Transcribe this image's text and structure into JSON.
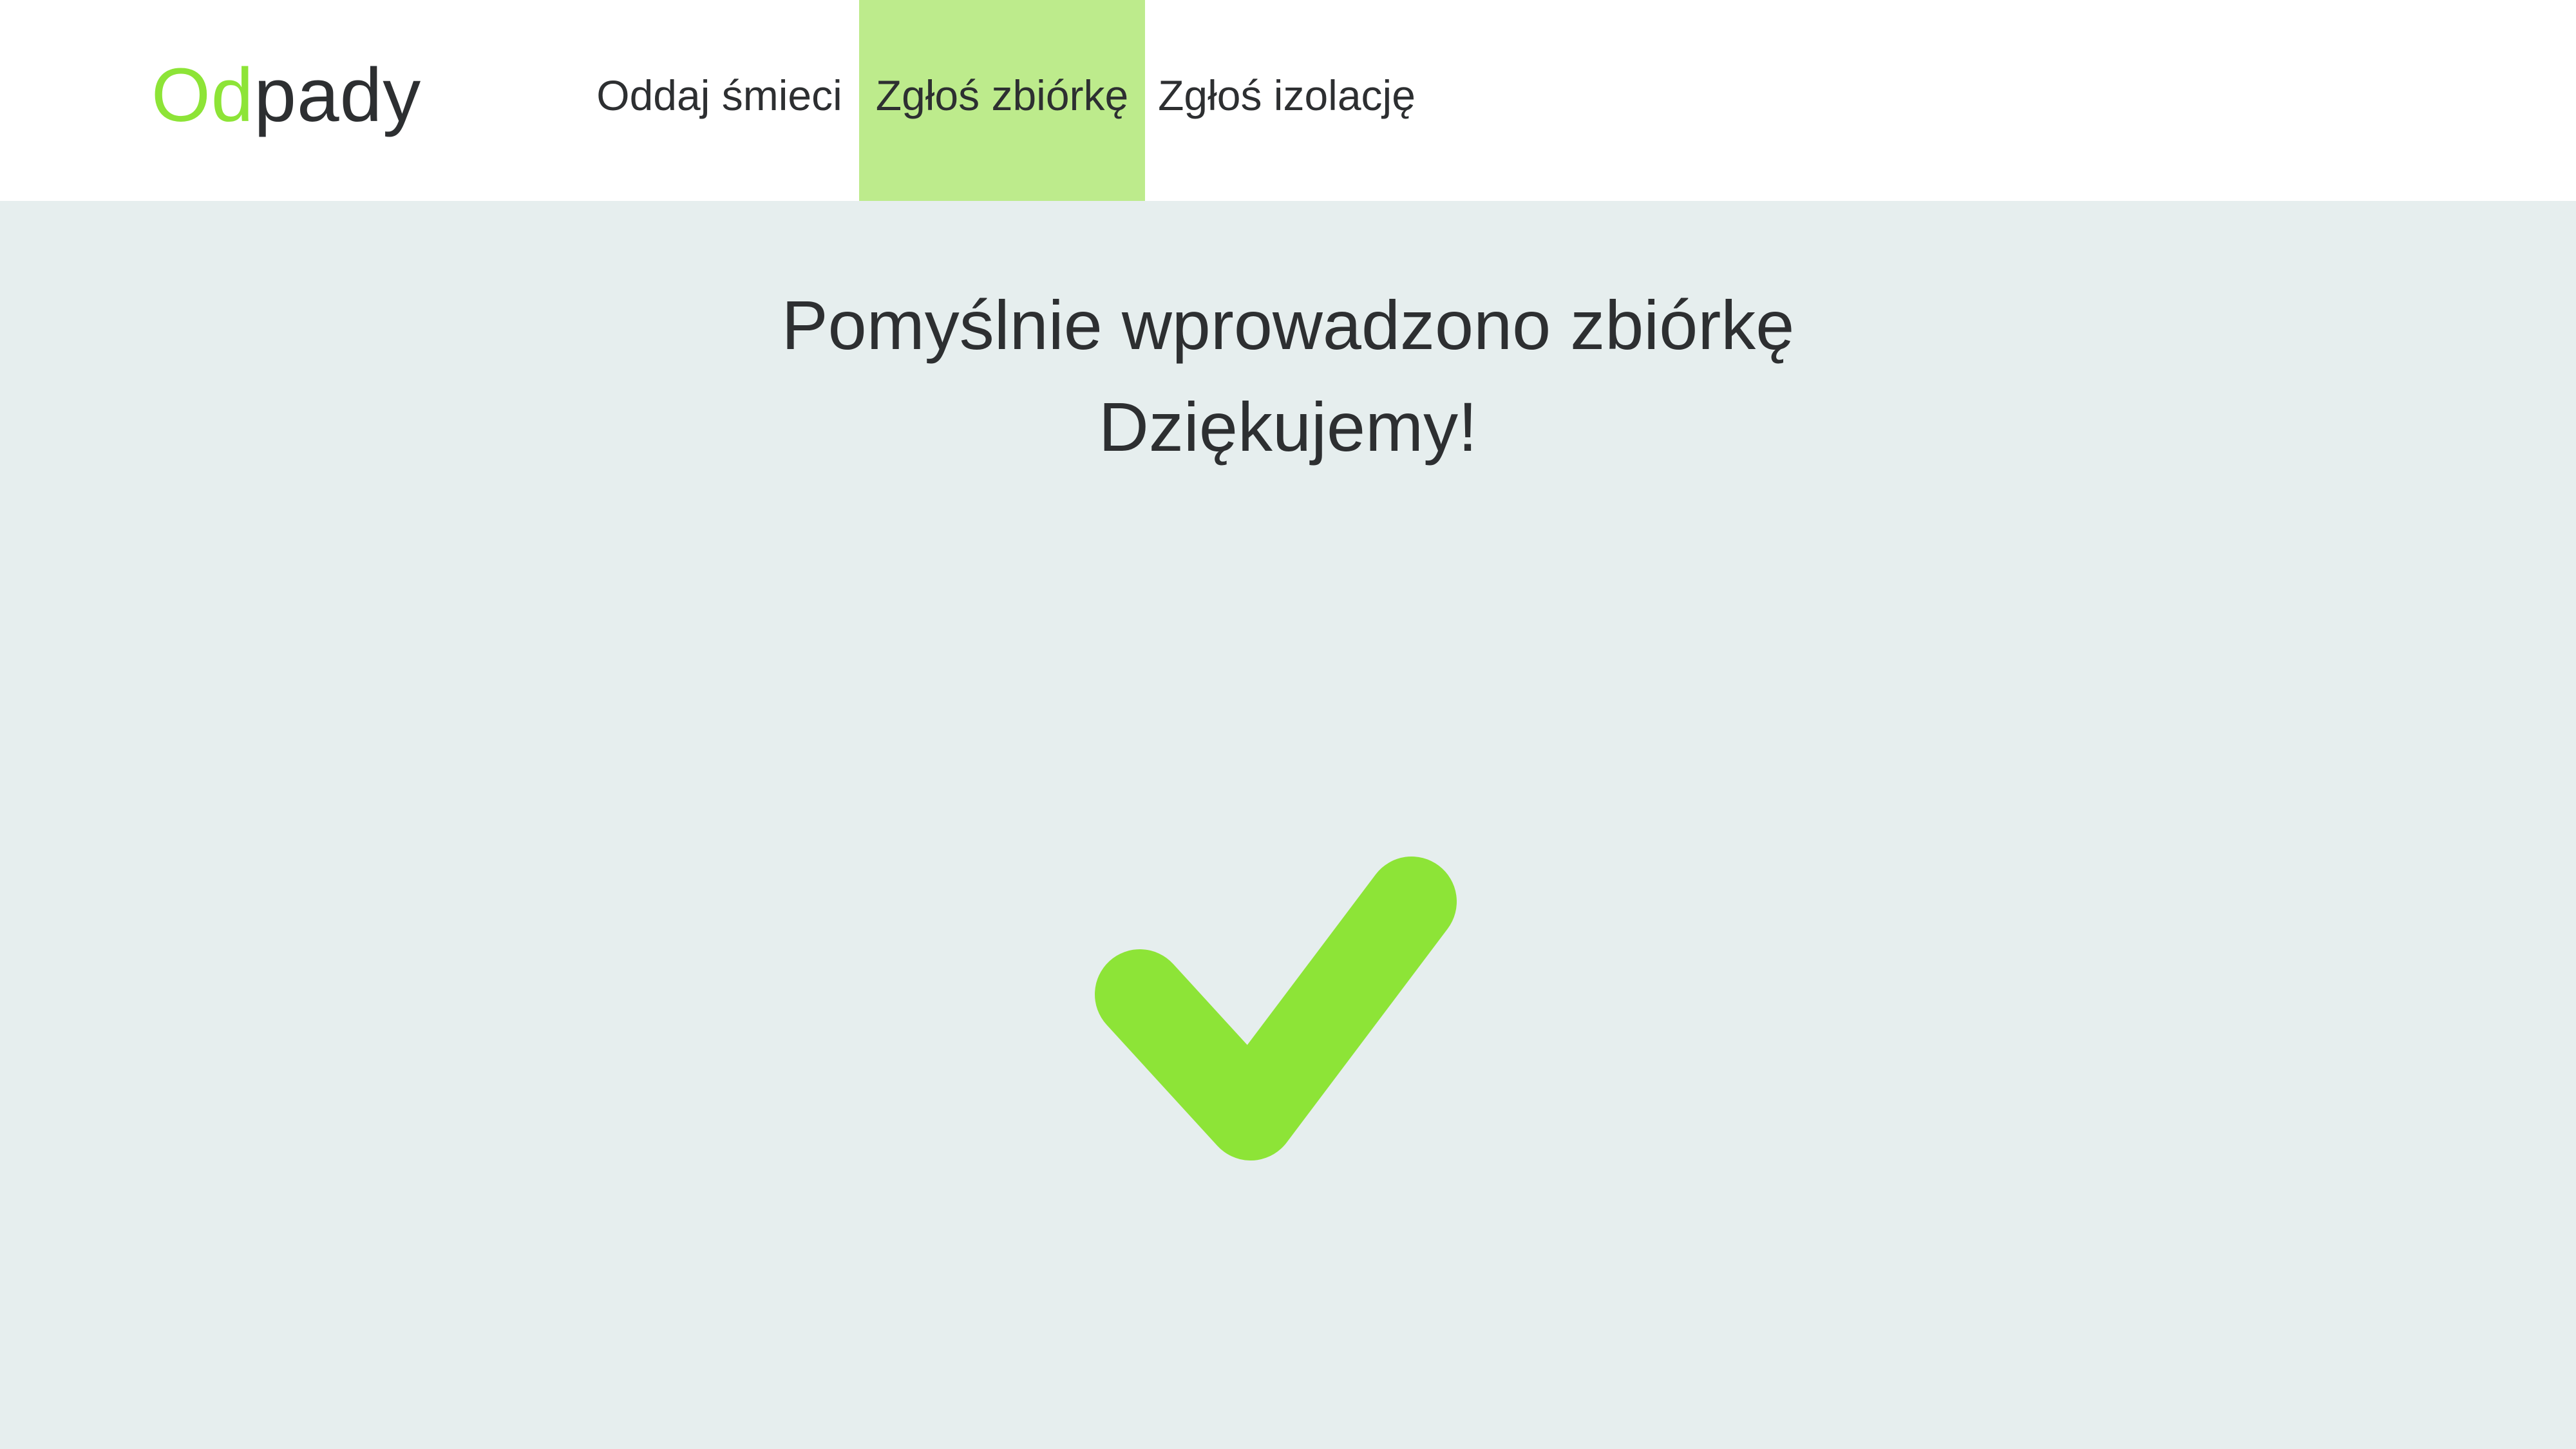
{
  "header": {
    "logo": {
      "accent": "Od",
      "rest": "pady",
      "accent_color": "#8de437"
    },
    "nav": [
      {
        "label": "Oddaj śmieci",
        "active": false
      },
      {
        "label": "Zgłoś zbiórkę",
        "active": true
      },
      {
        "label": "Zgłoś izolację",
        "active": false
      }
    ],
    "active_color": "#bdeb8c"
  },
  "main": {
    "message_line1": "Pomyślnie wprowadzono zbiórkę",
    "message_line2": "Dziękujemy!",
    "icon": "checkmark-icon",
    "icon_color": "#8de437",
    "background": "#e6eeee"
  }
}
